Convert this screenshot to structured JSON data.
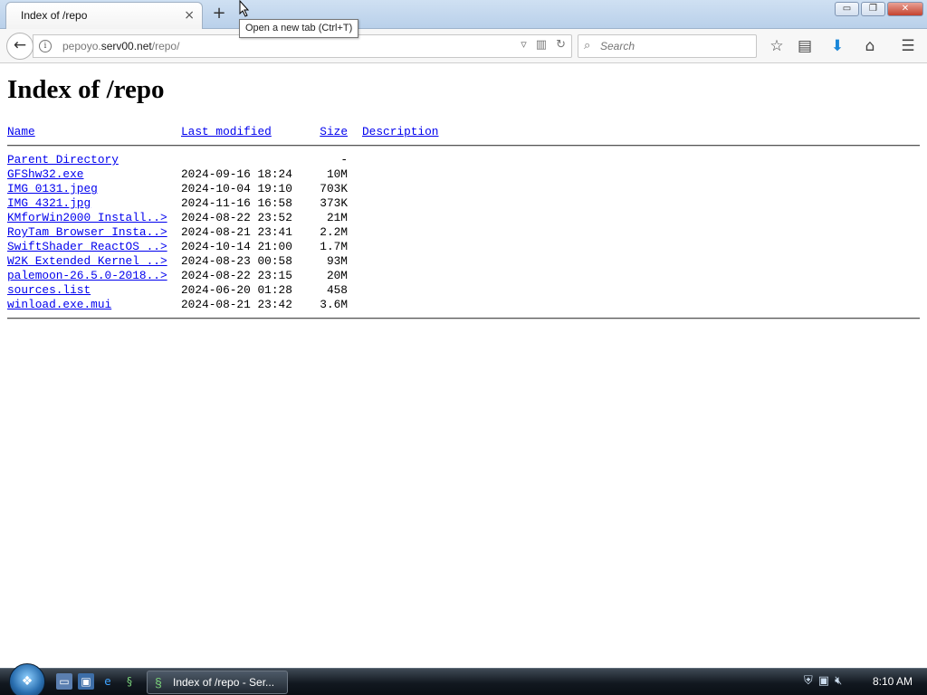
{
  "browser": {
    "tab_title": "Index of /repo",
    "tab_close": "×",
    "new_tab": "+",
    "tooltip": "Open a new tab (Ctrl+T)",
    "url_host": "pepoyo.serv00.net",
    "url_prefix": "pepoyo.",
    "url_domain": "serv00.net",
    "url_path": "/repo/",
    "search_placeholder": "Search",
    "window_buttons": {
      "minimize": "▭",
      "maximize": "❐",
      "close": "✕"
    },
    "icons": {
      "back": "back-arrow-icon",
      "info": "info-icon",
      "reader": "reader-view-icon",
      "reload": "reload-icon",
      "search": "search-icon",
      "bookmark": "star-icon",
      "library": "library-icon",
      "download": "download-icon",
      "home": "home-icon",
      "menu": "hamburger-menu-icon"
    }
  },
  "page": {
    "heading": "Index of /repo",
    "columns": {
      "name": "Name",
      "last_modified": "Last modified",
      "size": "Size",
      "description": "Description"
    },
    "parent": {
      "name": "Parent Directory",
      "size": "-"
    },
    "files": [
      {
        "name": "GFShw32.exe",
        "modified": "2024-09-16 18:24",
        "size": "10M"
      },
      {
        "name": "IMG_0131.jpeg",
        "modified": "2024-10-04 19:10",
        "size": "703K"
      },
      {
        "name": "IMG_4321.jpg",
        "modified": "2024-11-16 16:58",
        "size": "373K"
      },
      {
        "name": "KMforWin2000 Install..>",
        "modified": "2024-08-22 23:52",
        "size": "21M"
      },
      {
        "name": "RoyTam Browser Insta..>",
        "modified": "2024-08-21 23:41",
        "size": "2.2M"
      },
      {
        "name": "SwiftShader ReactOS ..>",
        "modified": "2024-10-14 21:00",
        "size": "1.7M"
      },
      {
        "name": "W2K Extended Kernel ..>",
        "modified": "2024-08-23 00:58",
        "size": "93M"
      },
      {
        "name": "palemoon-26.5.0-2018..>",
        "modified": "2024-08-22 23:15",
        "size": "20M"
      },
      {
        "name": "sources.list",
        "modified": "2024-06-20 01:28",
        "size": "458"
      },
      {
        "name": "winload.exe.mui",
        "modified": "2024-08-21 23:42",
        "size": "3.6M"
      }
    ]
  },
  "taskbar": {
    "task_label": "Index of /repo - Ser...",
    "clock": "8:10 AM"
  }
}
